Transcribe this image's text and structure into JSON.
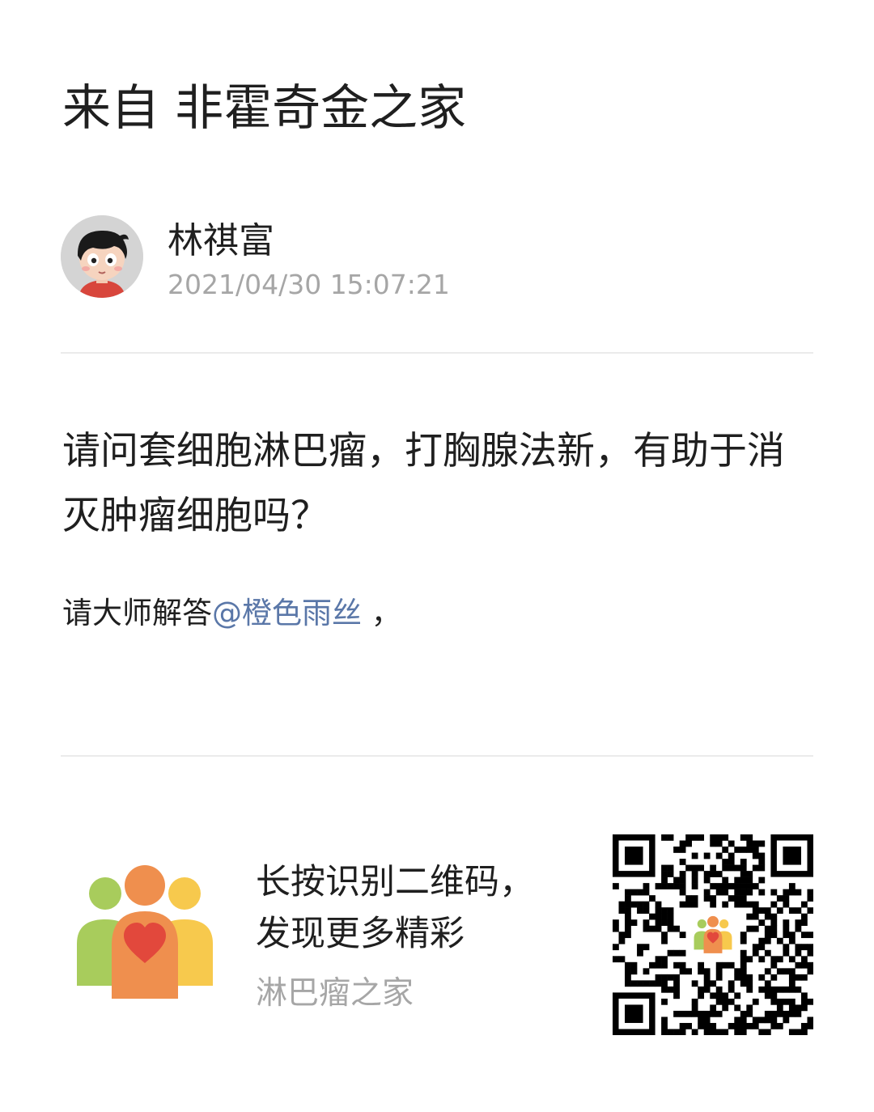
{
  "header": {
    "title": "来自 非霍奇金之家"
  },
  "post": {
    "author_name": "林祺富",
    "timestamp": "2021/04/30 15:07:21",
    "question": "请问套细胞淋巴瘤，打胸腺法新，有助于消灭肿瘤细胞吗？",
    "reply_prefix": "请大师解答",
    "reply_mention": "@橙色雨丝",
    "reply_suffix": " ，"
  },
  "promo": {
    "line1": "长按识别二维码，",
    "line2": "发现更多精彩",
    "source": "淋巴瘤之家"
  },
  "colors": {
    "mention": "#5a77a8",
    "secondary_text": "#a6a6a6",
    "divider": "#ebebeb",
    "logo_green": "#a8cc5c",
    "logo_orange": "#ef8f4e",
    "logo_yellow": "#f7c94d",
    "logo_heart": "#e2483c"
  },
  "icons": {
    "avatar": "cartoon-boy-avatar",
    "logo": "family-heart-logo",
    "qr": "qr-code"
  }
}
